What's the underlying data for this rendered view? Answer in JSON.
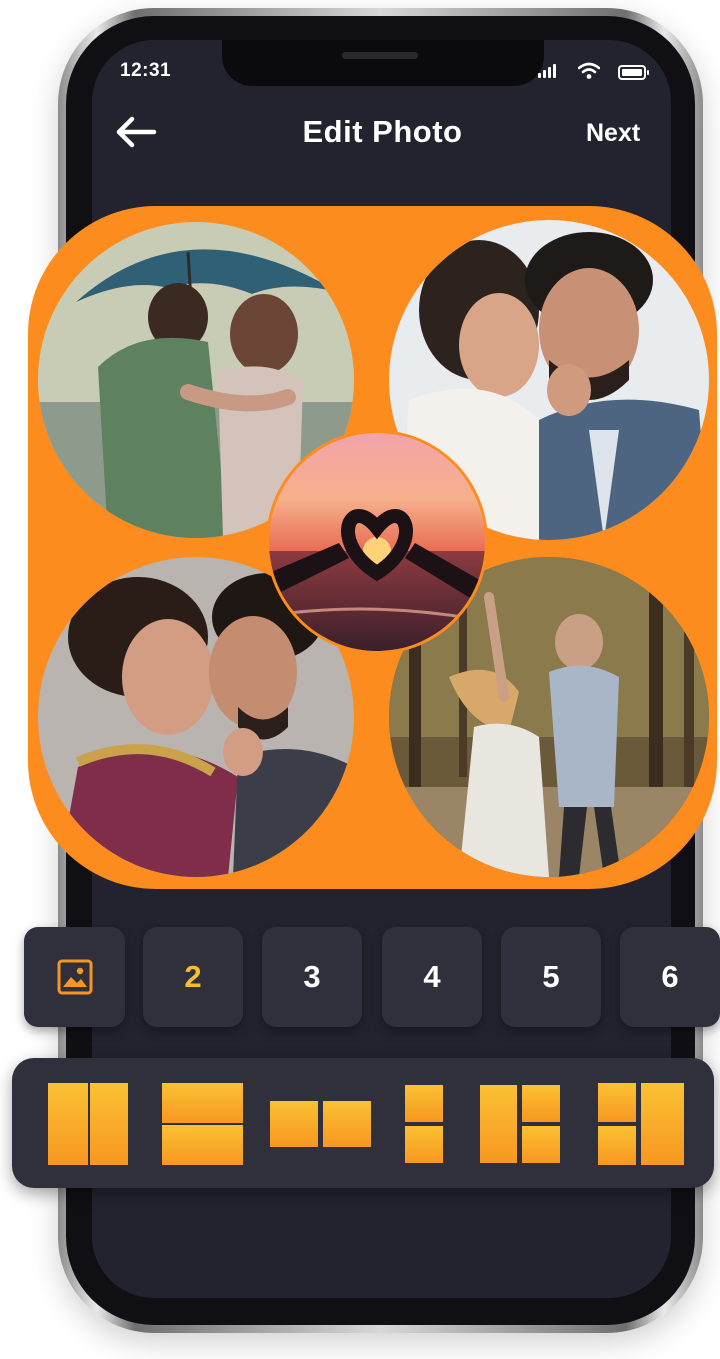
{
  "status_bar": {
    "time": "12:31"
  },
  "header": {
    "title": "Edit Photo",
    "next_label": "Next"
  },
  "collage": {
    "background_color": "#fc8c1d",
    "photos": [
      {
        "name": "couple-under-umbrella"
      },
      {
        "name": "bride-and-groom"
      },
      {
        "name": "couple-forehead-touch"
      },
      {
        "name": "couple-dancing-in-forest"
      },
      {
        "name": "heart-hands-sunset"
      }
    ]
  },
  "photo_count": {
    "icon": "image-icon",
    "options": [
      "2",
      "3",
      "4",
      "5",
      "6"
    ],
    "selected": "2"
  },
  "layouts": [
    {
      "name": "two-vertical"
    },
    {
      "name": "two-horizontal"
    },
    {
      "name": "two-side-by-side"
    },
    {
      "name": "two-stacked"
    },
    {
      "name": "one-large-two-right"
    },
    {
      "name": "two-left-one-large"
    }
  ],
  "colors": {
    "screen_bg": "#22232e",
    "button_bg": "#2f303c",
    "accent": "#fbbd2d",
    "collage_bg": "#fc8c1d"
  }
}
